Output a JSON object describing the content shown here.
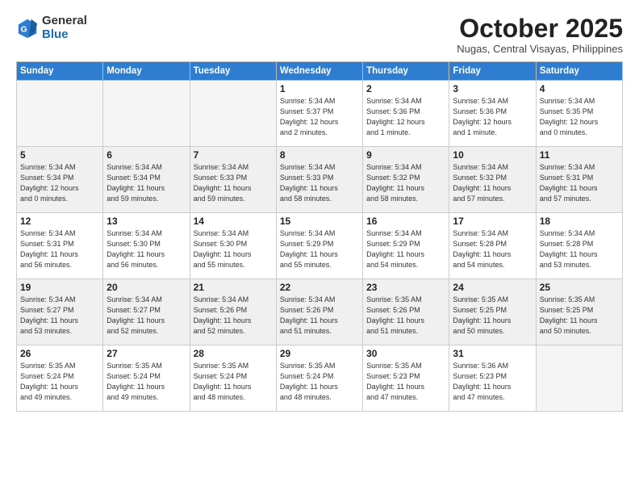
{
  "header": {
    "logo_general": "General",
    "logo_blue": "Blue",
    "month_title": "October 2025",
    "subtitle": "Nugas, Central Visayas, Philippines"
  },
  "days_of_week": [
    "Sunday",
    "Monday",
    "Tuesday",
    "Wednesday",
    "Thursday",
    "Friday",
    "Saturday"
  ],
  "weeks": [
    {
      "shaded": false,
      "days": [
        {
          "num": "",
          "info": ""
        },
        {
          "num": "",
          "info": ""
        },
        {
          "num": "",
          "info": ""
        },
        {
          "num": "1",
          "info": "Sunrise: 5:34 AM\nSunset: 5:37 PM\nDaylight: 12 hours\nand 2 minutes."
        },
        {
          "num": "2",
          "info": "Sunrise: 5:34 AM\nSunset: 5:36 PM\nDaylight: 12 hours\nand 1 minute."
        },
        {
          "num": "3",
          "info": "Sunrise: 5:34 AM\nSunset: 5:36 PM\nDaylight: 12 hours\nand 1 minute."
        },
        {
          "num": "4",
          "info": "Sunrise: 5:34 AM\nSunset: 5:35 PM\nDaylight: 12 hours\nand 0 minutes."
        }
      ]
    },
    {
      "shaded": true,
      "days": [
        {
          "num": "5",
          "info": "Sunrise: 5:34 AM\nSunset: 5:34 PM\nDaylight: 12 hours\nand 0 minutes."
        },
        {
          "num": "6",
          "info": "Sunrise: 5:34 AM\nSunset: 5:34 PM\nDaylight: 11 hours\nand 59 minutes."
        },
        {
          "num": "7",
          "info": "Sunrise: 5:34 AM\nSunset: 5:33 PM\nDaylight: 11 hours\nand 59 minutes."
        },
        {
          "num": "8",
          "info": "Sunrise: 5:34 AM\nSunset: 5:33 PM\nDaylight: 11 hours\nand 58 minutes."
        },
        {
          "num": "9",
          "info": "Sunrise: 5:34 AM\nSunset: 5:32 PM\nDaylight: 11 hours\nand 58 minutes."
        },
        {
          "num": "10",
          "info": "Sunrise: 5:34 AM\nSunset: 5:32 PM\nDaylight: 11 hours\nand 57 minutes."
        },
        {
          "num": "11",
          "info": "Sunrise: 5:34 AM\nSunset: 5:31 PM\nDaylight: 11 hours\nand 57 minutes."
        }
      ]
    },
    {
      "shaded": false,
      "days": [
        {
          "num": "12",
          "info": "Sunrise: 5:34 AM\nSunset: 5:31 PM\nDaylight: 11 hours\nand 56 minutes."
        },
        {
          "num": "13",
          "info": "Sunrise: 5:34 AM\nSunset: 5:30 PM\nDaylight: 11 hours\nand 56 minutes."
        },
        {
          "num": "14",
          "info": "Sunrise: 5:34 AM\nSunset: 5:30 PM\nDaylight: 11 hours\nand 55 minutes."
        },
        {
          "num": "15",
          "info": "Sunrise: 5:34 AM\nSunset: 5:29 PM\nDaylight: 11 hours\nand 55 minutes."
        },
        {
          "num": "16",
          "info": "Sunrise: 5:34 AM\nSunset: 5:29 PM\nDaylight: 11 hours\nand 54 minutes."
        },
        {
          "num": "17",
          "info": "Sunrise: 5:34 AM\nSunset: 5:28 PM\nDaylight: 11 hours\nand 54 minutes."
        },
        {
          "num": "18",
          "info": "Sunrise: 5:34 AM\nSunset: 5:28 PM\nDaylight: 11 hours\nand 53 minutes."
        }
      ]
    },
    {
      "shaded": true,
      "days": [
        {
          "num": "19",
          "info": "Sunrise: 5:34 AM\nSunset: 5:27 PM\nDaylight: 11 hours\nand 53 minutes."
        },
        {
          "num": "20",
          "info": "Sunrise: 5:34 AM\nSunset: 5:27 PM\nDaylight: 11 hours\nand 52 minutes."
        },
        {
          "num": "21",
          "info": "Sunrise: 5:34 AM\nSunset: 5:26 PM\nDaylight: 11 hours\nand 52 minutes."
        },
        {
          "num": "22",
          "info": "Sunrise: 5:34 AM\nSunset: 5:26 PM\nDaylight: 11 hours\nand 51 minutes."
        },
        {
          "num": "23",
          "info": "Sunrise: 5:35 AM\nSunset: 5:26 PM\nDaylight: 11 hours\nand 51 minutes."
        },
        {
          "num": "24",
          "info": "Sunrise: 5:35 AM\nSunset: 5:25 PM\nDaylight: 11 hours\nand 50 minutes."
        },
        {
          "num": "25",
          "info": "Sunrise: 5:35 AM\nSunset: 5:25 PM\nDaylight: 11 hours\nand 50 minutes."
        }
      ]
    },
    {
      "shaded": false,
      "days": [
        {
          "num": "26",
          "info": "Sunrise: 5:35 AM\nSunset: 5:24 PM\nDaylight: 11 hours\nand 49 minutes."
        },
        {
          "num": "27",
          "info": "Sunrise: 5:35 AM\nSunset: 5:24 PM\nDaylight: 11 hours\nand 49 minutes."
        },
        {
          "num": "28",
          "info": "Sunrise: 5:35 AM\nSunset: 5:24 PM\nDaylight: 11 hours\nand 48 minutes."
        },
        {
          "num": "29",
          "info": "Sunrise: 5:35 AM\nSunset: 5:24 PM\nDaylight: 11 hours\nand 48 minutes."
        },
        {
          "num": "30",
          "info": "Sunrise: 5:35 AM\nSunset: 5:23 PM\nDaylight: 11 hours\nand 47 minutes."
        },
        {
          "num": "31",
          "info": "Sunrise: 5:36 AM\nSunset: 5:23 PM\nDaylight: 11 hours\nand 47 minutes."
        },
        {
          "num": "",
          "info": ""
        }
      ]
    }
  ]
}
